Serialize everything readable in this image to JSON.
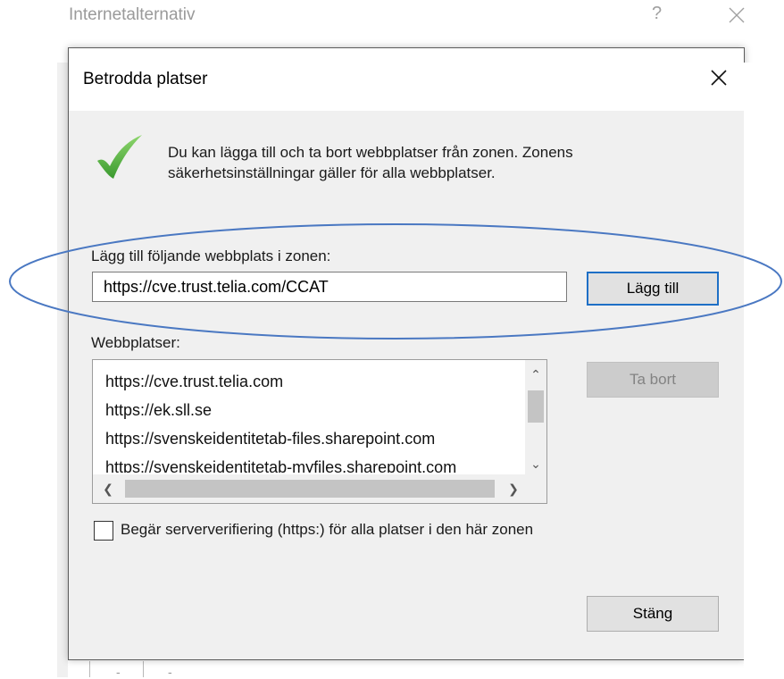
{
  "parent_window": {
    "title": "Internetalternativ",
    "help_glyph": "?",
    "close_icon": "close-icon",
    "bottom_fragment": [
      "-",
      "-"
    ]
  },
  "dialog": {
    "title": "Betrodda platser",
    "close_icon": "close-icon",
    "info_icon": "green-checkmark-icon",
    "info_text": "Du kan lägga till och ta bort webbplatser från zonen. Zonens säkerhetsinställningar gäller för alla webbplatser.",
    "add_label": "Lägg till följande webbplats i zonen:",
    "add_input_value": "https://cve.trust.telia.com/CCAT",
    "add_button": "Lägg till",
    "sites_label": "Webbplatser:",
    "sites": [
      "https://cve.trust.telia.com",
      "https://ek.sll.se",
      "https://svenskeidentitetab-files.sharepoint.com",
      "https://svenskeidentitetab-myfiles.sharepoint.com"
    ],
    "remove_button": "Ta bort",
    "require_https_label": "Begär serververifiering (https:) för alla platser i den här zonen",
    "require_https_checked": false,
    "close_button": "Stäng"
  },
  "colors": {
    "dialog_bg": "#f0f0f0",
    "accent_border": "#1e6fc6",
    "annotation_ellipse": "#4a78c2",
    "checkmark_green": "#4caf3c"
  }
}
